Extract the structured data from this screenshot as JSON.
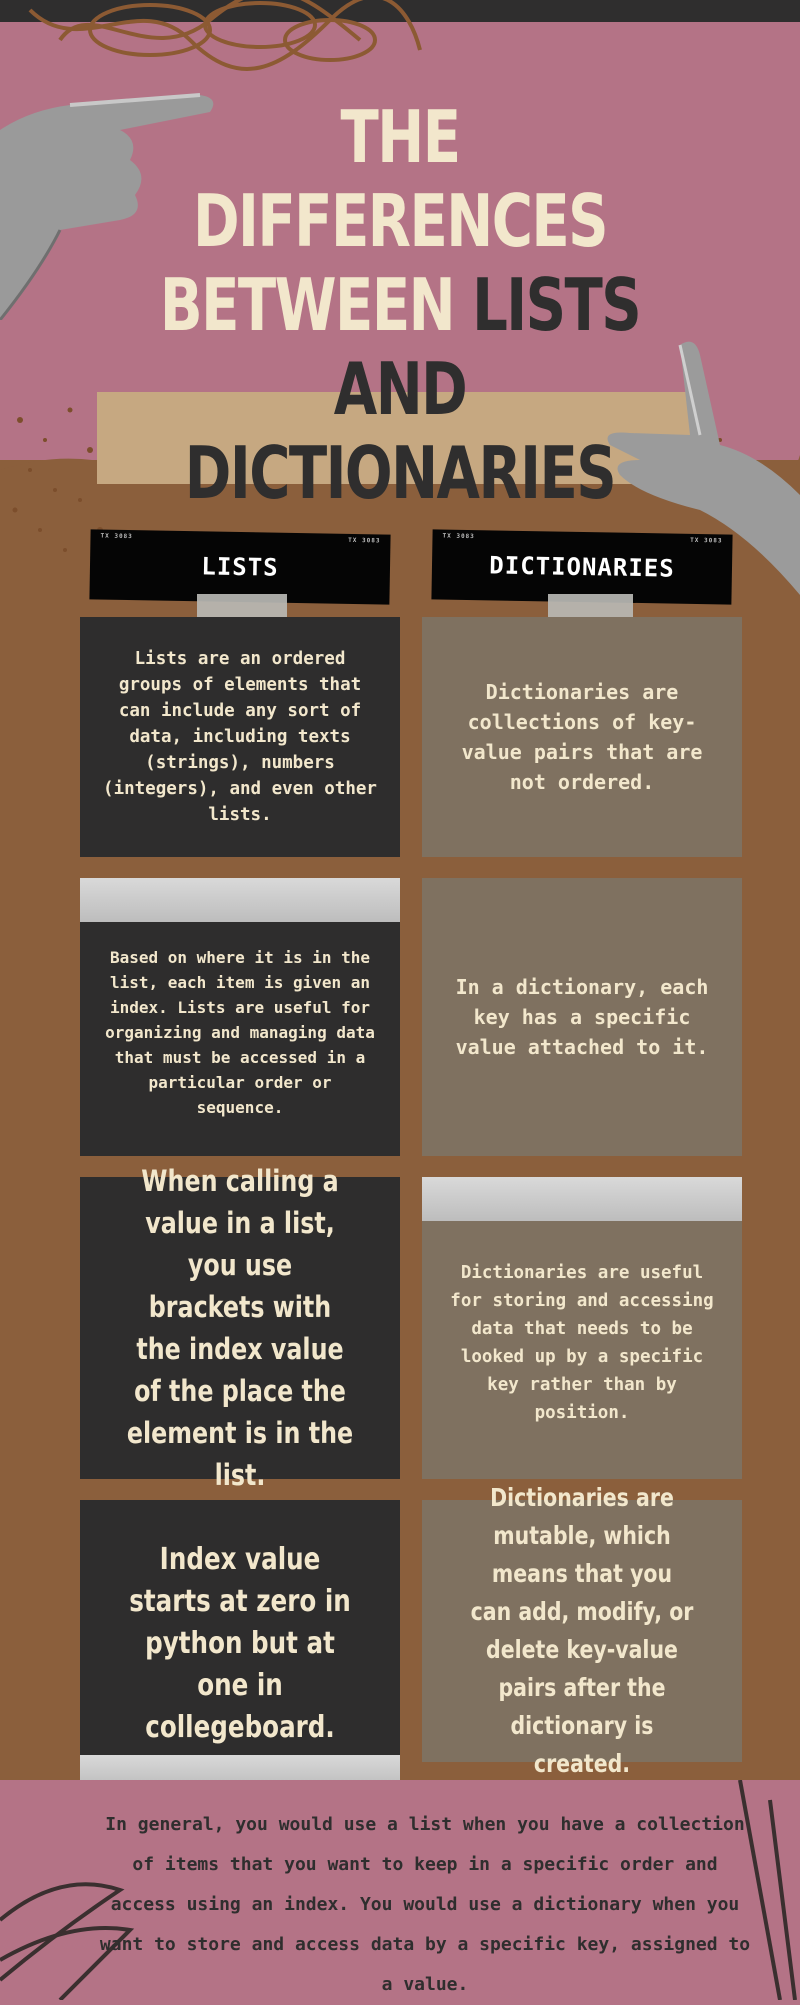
{
  "title": {
    "line1": "THE DIFFERENCES",
    "line2a": "BETWEEN ",
    "line2b": "LISTS AND",
    "line3": "DICTIONARIES"
  },
  "headers": {
    "lists": "LISTS",
    "dictionaries": "DICTIONARIES",
    "tick_left": "TX 3083",
    "tick_right": "TX 3083"
  },
  "cards": {
    "lists_1": "Lists are an ordered groups of elements that can include any sort of data, including texts (strings), numbers (integers), and even other lists.",
    "dict_1": "Dictionaries are collections of key-value pairs that are not ordered.",
    "lists_2": "Based on where it is in the list, each item is given an index. Lists are useful for organizing and managing data that must be accessed in a particular order or sequence.",
    "dict_2": "In a dictionary, each key has a specific value attached to it.",
    "lists_3": "When calling a value in a list, you use brackets with the index value of the place the element is in the list.",
    "dict_3": "Dictionaries are useful for storing and accessing data that needs to be looked up by a specific key rather than by position.",
    "lists_4": "Index value starts at zero in python but at one in collegeboard.",
    "dict_4": "Dictionaries are mutable, which means that you can add, modify, or delete key-value pairs after the dictionary is created."
  },
  "summary": "In general, you would use a list when you have a collection of items that you want to keep in a specific order and access using an index. You would use a dictionary when you want to store and access data by a specific key, assigned to a value.",
  "colors": {
    "pink": "#b47386",
    "brown": "#8b5f3c",
    "charcoal": "#2e2d2d",
    "taupe": "#7f7160",
    "cream": "#f2e7cc"
  },
  "icons": {
    "top_left": "hand-pointing-icon",
    "top_right": "hand-pinching-icon"
  }
}
